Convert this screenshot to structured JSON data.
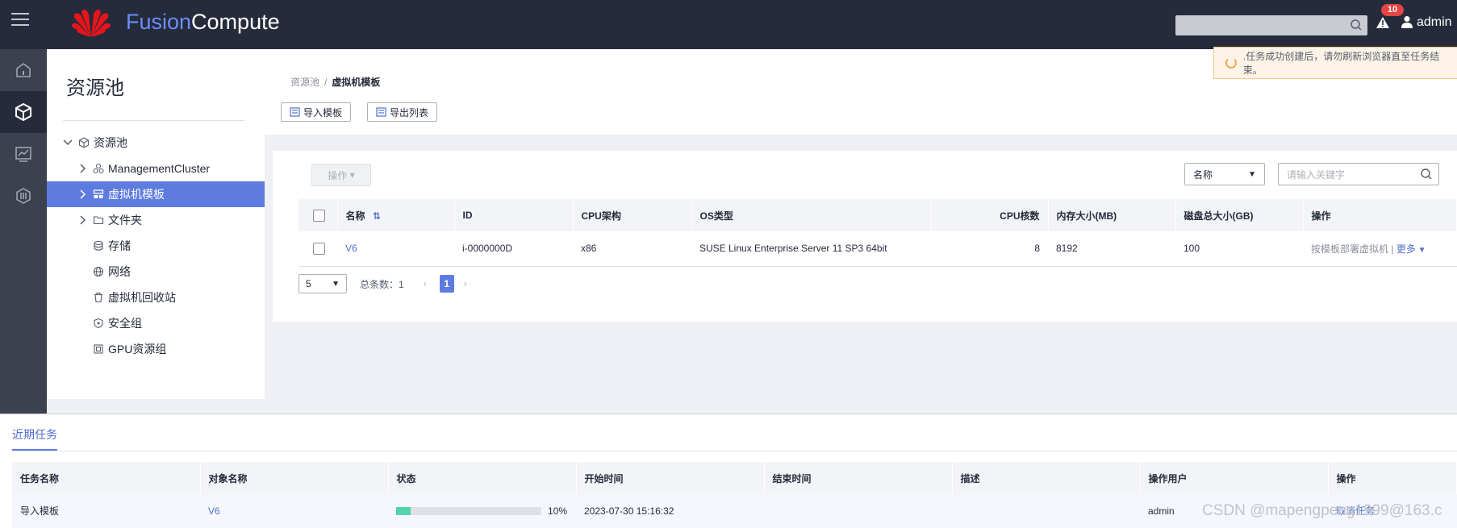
{
  "header": {
    "brand_part1": "Fusion",
    "brand_part2": "Compute",
    "alarm_count": "10",
    "user": "admin"
  },
  "tree": {
    "title": "资源池",
    "items": [
      {
        "label": "资源池",
        "icon": "cube-icon",
        "expanded": true
      },
      {
        "label": "ManagementCluster",
        "icon": "cluster-icon"
      },
      {
        "label": "虚拟机模板",
        "icon": "template-icon",
        "selected": true
      },
      {
        "label": "文件夹",
        "icon": "folder-icon"
      },
      {
        "label": "存储",
        "icon": "storage-icon"
      },
      {
        "label": "网络",
        "icon": "globe-icon"
      },
      {
        "label": "虚拟机回收站",
        "icon": "trash-icon"
      },
      {
        "label": "安全组",
        "icon": "shield-icon"
      },
      {
        "label": "GPU资源组",
        "icon": "chip-icon"
      }
    ]
  },
  "breadcrumb": {
    "root": "资源池",
    "sep": "/",
    "current": "虚拟机模板"
  },
  "toolbar": {
    "import_label": "导入模板",
    "export_label": "导出列表",
    "operation_label": "操作",
    "filter_field": "名称",
    "search_placeholder": "请输入关键字"
  },
  "toast": {
    "message": ".任务成功创建后，请勿刷新浏览器直至任务结束。"
  },
  "table": {
    "columns": [
      "名称",
      "ID",
      "CPU架构",
      "OS类型",
      "CPU核数",
      "内存大小(MB)",
      "磁盘总大小(GB)",
      "操作"
    ],
    "rows": [
      {
        "name": "V6",
        "id": "i-0000000D",
        "cpu_arch": "x86",
        "os_type": "SUSE Linux Enterprise Server 11 SP3 64bit",
        "cpu_cores": "8",
        "memory": "8192",
        "disk": "100",
        "action_deploy": "按模板部署虚拟机",
        "action_sep": "|",
        "action_more": "更多"
      }
    ]
  },
  "pager": {
    "page_size": "5",
    "total_label": "总条数：1",
    "current_page": "1"
  },
  "tasks": {
    "tab_label": "近期任务",
    "columns": [
      "任务名称",
      "对象名称",
      "状态",
      "开始时间",
      "结束时间",
      "描述",
      "操作用户",
      "操作"
    ],
    "rows": [
      {
        "task_name": "导入模板",
        "object_name": "V6",
        "progress": 10,
        "progress_label": "10%",
        "start_time": "2023-07-30 15:16:32",
        "end_time": "",
        "description": "",
        "user": "admin",
        "action": "取消任务"
      }
    ]
  },
  "watermark": "CSDN @mapengpeng1999@163.c",
  "colors": {
    "topbar": "#252b3a",
    "accent": "#5e7ce0",
    "link": "#526ecc",
    "progress": "#50d4ab",
    "badge": "#e54545"
  }
}
